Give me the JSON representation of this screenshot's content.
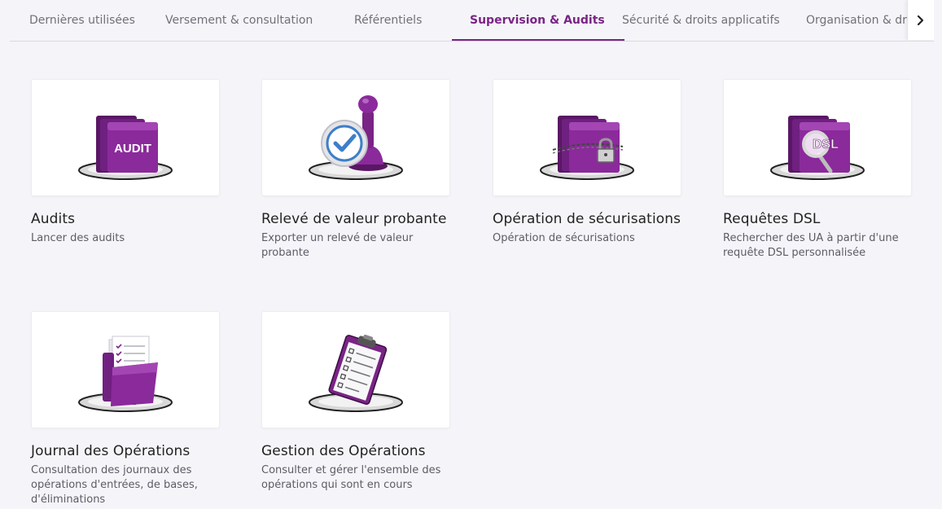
{
  "tabs": [
    {
      "label": "Dernières utilisées"
    },
    {
      "label": "Versement & consultation"
    },
    {
      "label": "Référentiels"
    },
    {
      "label": "Supervision & Audits",
      "active": true
    },
    {
      "label": "Sécurité & droits applicatifs"
    },
    {
      "label": "Organisation & droits"
    }
  ],
  "tab_next_icon": "chevron-right-icon",
  "colors": {
    "accent": "#7a2485",
    "folder_purple": "#8b2a9b",
    "background": "#f5f5f9"
  },
  "tiles": [
    {
      "title": "Audits",
      "description": "Lancer des audits",
      "icon": "audit-folder-icon",
      "icon_text": "AUDIT"
    },
    {
      "title": "Relevé de valeur probante",
      "description": "Exporter un relevé de valeur probante",
      "icon": "stamp-check-icon"
    },
    {
      "title": "Opération de sécurisations",
      "description": "Opération de sécurisations",
      "icon": "locked-folder-icon"
    },
    {
      "title": "Requêtes DSL",
      "description": "Rechercher des UA à partir d'une requête DSL personnalisée",
      "icon": "dsl-folder-icon",
      "icon_text": "DSL"
    },
    {
      "title": "Journal des Opérations",
      "description": "Consultation des journaux des opérations d'entrées, de bases, d'éliminations",
      "icon": "journal-folder-icon"
    },
    {
      "title": "Gestion des Opérations",
      "description": "Consulter et gérer l'ensemble des opérations qui sont en cours",
      "icon": "clipboard-icon"
    }
  ]
}
